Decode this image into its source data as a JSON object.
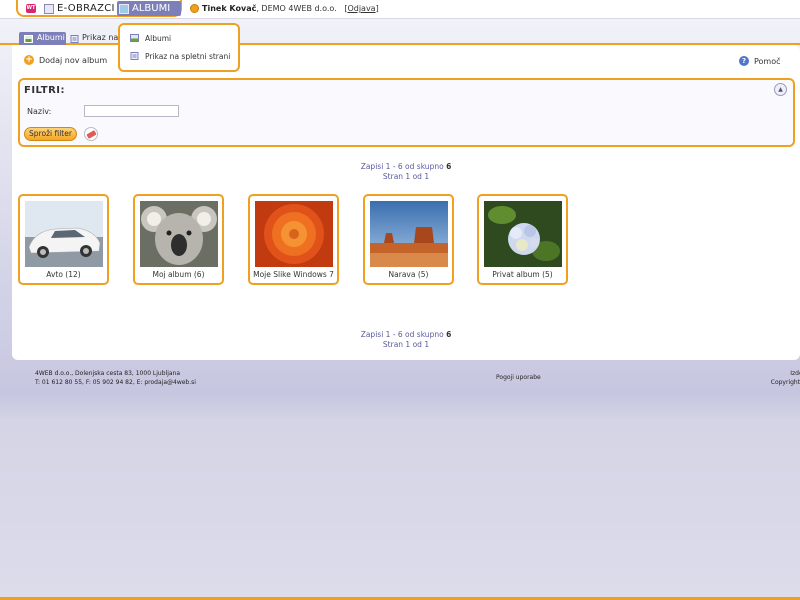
{
  "app": {
    "logo_text": "WT",
    "nav": {
      "eobrazci": "E-OBRAZCI",
      "albumi": "ALBUMI"
    },
    "user": {
      "name": "Tinek Kovač",
      "company": ", DEMO 4WEB d.o.o.",
      "logout": "Odjava"
    }
  },
  "dropdown": {
    "items": [
      {
        "label": "Albumi",
        "icon": "image-icon"
      },
      {
        "label": "Prikaz na spletni strani",
        "icon": "page-icon"
      }
    ]
  },
  "tabs": [
    {
      "label": "Albumi",
      "active": true
    },
    {
      "label": "Prikaz na",
      "active": false
    }
  ],
  "toolbar": {
    "add_album": "Dodaj nov album",
    "help": "Pomoč"
  },
  "filters": {
    "title": "FILTRI:",
    "naziv_label": "Naziv:",
    "naziv_value": "",
    "submit": "Sproži filter"
  },
  "pager": {
    "records_text": "Zapisi 1 - 6 od skupno ",
    "total": "6",
    "page_text": "Stran 1 od 1"
  },
  "albums": [
    {
      "title": "Avto (12)",
      "thumb": "car"
    },
    {
      "title": "Moj album (6)",
      "thumb": "koala"
    },
    {
      "title": "Moje Slike Windows 7",
      "thumb": "flower"
    },
    {
      "title": "Narava (5)",
      "thumb": "desert"
    },
    {
      "title": "Privat album (5)",
      "thumb": "hydrangea"
    }
  ],
  "footer": {
    "address": "4WEB d.o.o., Dolenjska cesta 83, 1000 Ljubljana",
    "contact": "T: 01 612 80 55, F: 05 902 94 82, E: prodaja@4web.si",
    "terms": "Pogoji uporabe",
    "right1": "Izdela",
    "right2": "Copyright ©"
  },
  "colors": {
    "accent": "#f0a020",
    "nav_active": "#7d80b8",
    "link": "#5a5aa0"
  }
}
